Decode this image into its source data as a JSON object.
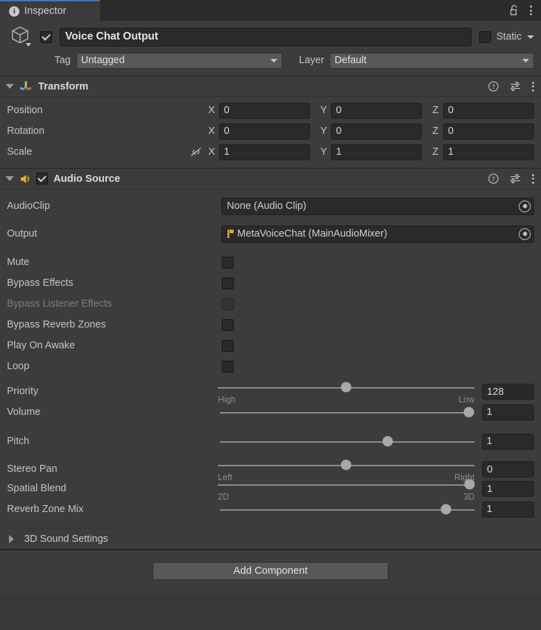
{
  "window": {
    "tab_label": "Inspector",
    "tab_icon": "info-icon",
    "lock_icon": "lock-open-icon",
    "menu_icon": "kebab-menu-icon",
    "accent_color": "#3a79c8",
    "background_color": "#383838"
  },
  "gameobject": {
    "icon": "cube-icon",
    "enabled": true,
    "name_value": "Voice Chat Output",
    "static_label": "Static",
    "static_checked": false,
    "tag_label": "Tag",
    "tag_value": "Untagged",
    "layer_label": "Layer",
    "layer_value": "Default"
  },
  "transform": {
    "title": "Transform",
    "icon": "transform-axis-icon",
    "expanded": true,
    "help_icon": "help-icon",
    "preset_icon": "preset-sliders-icon",
    "menu_icon": "kebab-menu-icon",
    "rows": [
      {
        "label": "Position",
        "x": "0",
        "y": "0",
        "z": "0",
        "link_icon": null
      },
      {
        "label": "Rotation",
        "x": "0",
        "y": "0",
        "z": "0",
        "link_icon": null
      },
      {
        "label": "Scale",
        "x": "1",
        "y": "1",
        "z": "1",
        "link_icon": "scale-unlinked-icon"
      }
    ],
    "axis_labels": [
      "X",
      "Y",
      "Z"
    ]
  },
  "audio_source": {
    "title": "Audio Source",
    "icon": "audio-source-icon",
    "enabled": true,
    "expanded": true,
    "help_icon": "help-icon",
    "preset_icon": "preset-sliders-icon",
    "menu_icon": "kebab-menu-icon",
    "audioclip": {
      "label": "AudioClip",
      "value": "None (Audio Clip)",
      "picker_icon": "object-picker-icon"
    },
    "output": {
      "label": "Output",
      "value": "MetaVoiceChat (MainAudioMixer)",
      "icon": "audio-mixer-icon",
      "picker_icon": "object-picker-icon"
    },
    "toggles": [
      {
        "label": "Mute",
        "checked": false,
        "disabled": false
      },
      {
        "label": "Bypass Effects",
        "checked": false,
        "disabled": false
      },
      {
        "label": "Bypass Listener Effects",
        "checked": false,
        "disabled": true
      },
      {
        "label": "Bypass Reverb Zones",
        "checked": false,
        "disabled": false
      },
      {
        "label": "Play On Awake",
        "checked": false,
        "disabled": false
      },
      {
        "label": "Loop",
        "checked": false,
        "disabled": false
      }
    ],
    "sliders": [
      {
        "label": "Priority",
        "value": "128",
        "percent": 50,
        "min_label": "High",
        "max_label": "Low"
      },
      {
        "label": "Volume",
        "value": "1",
        "percent": 100,
        "min_label": "",
        "max_label": ""
      },
      {
        "label": "Pitch",
        "value": "1",
        "percent": 66,
        "min_label": "",
        "max_label": ""
      },
      {
        "label": "Stereo Pan",
        "value": "0",
        "percent": 50,
        "min_label": "Left",
        "max_label": "Right"
      },
      {
        "label": "Spatial Blend",
        "value": "1",
        "percent": 100,
        "min_label": "2D",
        "max_label": "3D"
      },
      {
        "label": "Reverb Zone Mix",
        "value": "1",
        "percent": 89,
        "min_label": "",
        "max_label": ""
      }
    ],
    "sound3d": {
      "label": "3D Sound Settings",
      "expanded": false
    }
  },
  "footer": {
    "add_component_label": "Add Component"
  }
}
